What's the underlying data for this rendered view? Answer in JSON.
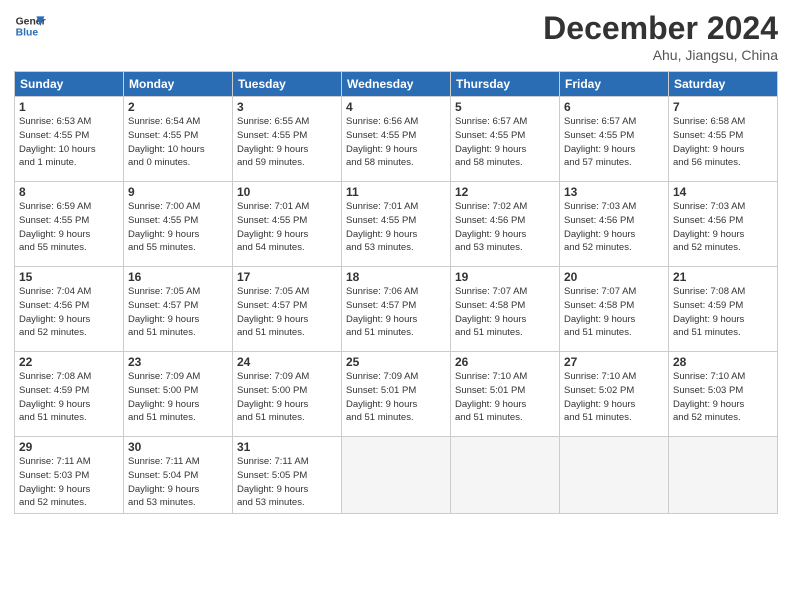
{
  "header": {
    "logo_line1": "General",
    "logo_line2": "Blue",
    "month_title": "December 2024",
    "location": "Ahu, Jiangsu, China"
  },
  "weekdays": [
    "Sunday",
    "Monday",
    "Tuesday",
    "Wednesday",
    "Thursday",
    "Friday",
    "Saturday"
  ],
  "weeks": [
    [
      {
        "day": "1",
        "info": "Sunrise: 6:53 AM\nSunset: 4:55 PM\nDaylight: 10 hours\nand 1 minute."
      },
      {
        "day": "2",
        "info": "Sunrise: 6:54 AM\nSunset: 4:55 PM\nDaylight: 10 hours\nand 0 minutes."
      },
      {
        "day": "3",
        "info": "Sunrise: 6:55 AM\nSunset: 4:55 PM\nDaylight: 9 hours\nand 59 minutes."
      },
      {
        "day": "4",
        "info": "Sunrise: 6:56 AM\nSunset: 4:55 PM\nDaylight: 9 hours\nand 58 minutes."
      },
      {
        "day": "5",
        "info": "Sunrise: 6:57 AM\nSunset: 4:55 PM\nDaylight: 9 hours\nand 58 minutes."
      },
      {
        "day": "6",
        "info": "Sunrise: 6:57 AM\nSunset: 4:55 PM\nDaylight: 9 hours\nand 57 minutes."
      },
      {
        "day": "7",
        "info": "Sunrise: 6:58 AM\nSunset: 4:55 PM\nDaylight: 9 hours\nand 56 minutes."
      }
    ],
    [
      {
        "day": "8",
        "info": "Sunrise: 6:59 AM\nSunset: 4:55 PM\nDaylight: 9 hours\nand 55 minutes."
      },
      {
        "day": "9",
        "info": "Sunrise: 7:00 AM\nSunset: 4:55 PM\nDaylight: 9 hours\nand 55 minutes."
      },
      {
        "day": "10",
        "info": "Sunrise: 7:01 AM\nSunset: 4:55 PM\nDaylight: 9 hours\nand 54 minutes."
      },
      {
        "day": "11",
        "info": "Sunrise: 7:01 AM\nSunset: 4:55 PM\nDaylight: 9 hours\nand 53 minutes."
      },
      {
        "day": "12",
        "info": "Sunrise: 7:02 AM\nSunset: 4:56 PM\nDaylight: 9 hours\nand 53 minutes."
      },
      {
        "day": "13",
        "info": "Sunrise: 7:03 AM\nSunset: 4:56 PM\nDaylight: 9 hours\nand 52 minutes."
      },
      {
        "day": "14",
        "info": "Sunrise: 7:03 AM\nSunset: 4:56 PM\nDaylight: 9 hours\nand 52 minutes."
      }
    ],
    [
      {
        "day": "15",
        "info": "Sunrise: 7:04 AM\nSunset: 4:56 PM\nDaylight: 9 hours\nand 52 minutes."
      },
      {
        "day": "16",
        "info": "Sunrise: 7:05 AM\nSunset: 4:57 PM\nDaylight: 9 hours\nand 51 minutes."
      },
      {
        "day": "17",
        "info": "Sunrise: 7:05 AM\nSunset: 4:57 PM\nDaylight: 9 hours\nand 51 minutes."
      },
      {
        "day": "18",
        "info": "Sunrise: 7:06 AM\nSunset: 4:57 PM\nDaylight: 9 hours\nand 51 minutes."
      },
      {
        "day": "19",
        "info": "Sunrise: 7:07 AM\nSunset: 4:58 PM\nDaylight: 9 hours\nand 51 minutes."
      },
      {
        "day": "20",
        "info": "Sunrise: 7:07 AM\nSunset: 4:58 PM\nDaylight: 9 hours\nand 51 minutes."
      },
      {
        "day": "21",
        "info": "Sunrise: 7:08 AM\nSunset: 4:59 PM\nDaylight: 9 hours\nand 51 minutes."
      }
    ],
    [
      {
        "day": "22",
        "info": "Sunrise: 7:08 AM\nSunset: 4:59 PM\nDaylight: 9 hours\nand 51 minutes."
      },
      {
        "day": "23",
        "info": "Sunrise: 7:09 AM\nSunset: 5:00 PM\nDaylight: 9 hours\nand 51 minutes."
      },
      {
        "day": "24",
        "info": "Sunrise: 7:09 AM\nSunset: 5:00 PM\nDaylight: 9 hours\nand 51 minutes."
      },
      {
        "day": "25",
        "info": "Sunrise: 7:09 AM\nSunset: 5:01 PM\nDaylight: 9 hours\nand 51 minutes."
      },
      {
        "day": "26",
        "info": "Sunrise: 7:10 AM\nSunset: 5:01 PM\nDaylight: 9 hours\nand 51 minutes."
      },
      {
        "day": "27",
        "info": "Sunrise: 7:10 AM\nSunset: 5:02 PM\nDaylight: 9 hours\nand 51 minutes."
      },
      {
        "day": "28",
        "info": "Sunrise: 7:10 AM\nSunset: 5:03 PM\nDaylight: 9 hours\nand 52 minutes."
      }
    ],
    [
      {
        "day": "29",
        "info": "Sunrise: 7:11 AM\nSunset: 5:03 PM\nDaylight: 9 hours\nand 52 minutes."
      },
      {
        "day": "30",
        "info": "Sunrise: 7:11 AM\nSunset: 5:04 PM\nDaylight: 9 hours\nand 53 minutes."
      },
      {
        "day": "31",
        "info": "Sunrise: 7:11 AM\nSunset: 5:05 PM\nDaylight: 9 hours\nand 53 minutes."
      },
      {
        "day": "",
        "info": ""
      },
      {
        "day": "",
        "info": ""
      },
      {
        "day": "",
        "info": ""
      },
      {
        "day": "",
        "info": ""
      }
    ]
  ]
}
